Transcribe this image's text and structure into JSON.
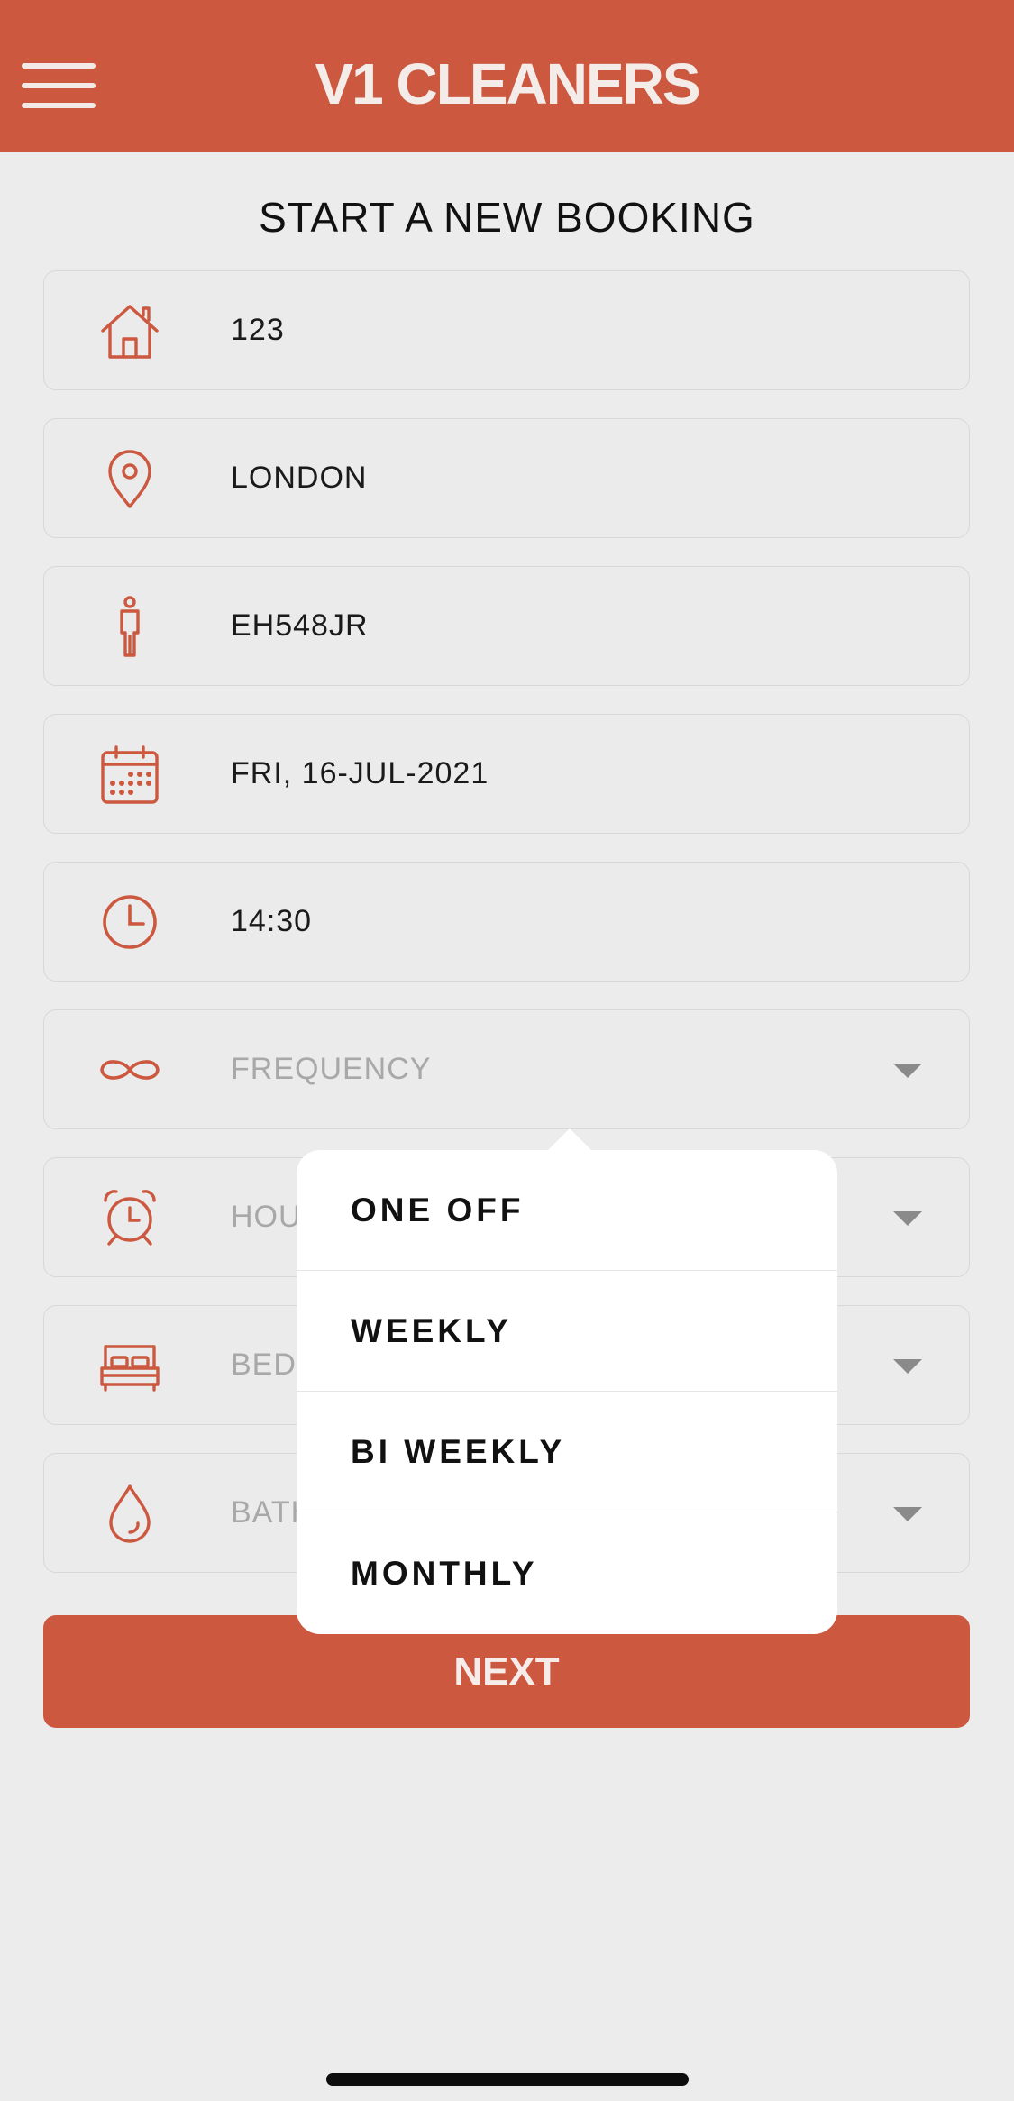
{
  "header": {
    "title": "V1 CLEANERS",
    "menu_icon": "hamburger-menu-icon",
    "background_color": "#cc5840"
  },
  "page_title": "START A NEW BOOKING",
  "fields": [
    {
      "icon": "house-icon",
      "value": "123",
      "is_placeholder": false
    },
    {
      "icon": "location-pin-icon",
      "value": "LONDON",
      "is_placeholder": false
    },
    {
      "icon": "person-icon",
      "value": "EH548JR",
      "is_placeholder": false
    },
    {
      "icon": "calendar-icon",
      "value": "FRI, 16-JUL-2021",
      "is_placeholder": false
    },
    {
      "icon": "clock-icon",
      "value": "14:30",
      "is_placeholder": false
    },
    {
      "icon": "infinity-icon",
      "value": "FREQUENCY",
      "is_placeholder": true,
      "dropdown": true
    },
    {
      "icon": "alarm-clock-icon",
      "value": "HOU",
      "is_placeholder": true,
      "dropdown": true
    },
    {
      "icon": "bed-icon",
      "value": "BEDR",
      "is_placeholder": true,
      "dropdown": true
    },
    {
      "icon": "droplet-icon",
      "value": "BATH",
      "is_placeholder": true,
      "dropdown": true
    }
  ],
  "frequency_menu": {
    "options": [
      "ONE OFF",
      "WEEKLY",
      "BI WEEKLY",
      "MONTHLY"
    ]
  },
  "next_button": {
    "label": "NEXT"
  },
  "colors": {
    "accent": "#cc5840",
    "background": "#ececec",
    "placeholder": "#a8a8a8"
  }
}
